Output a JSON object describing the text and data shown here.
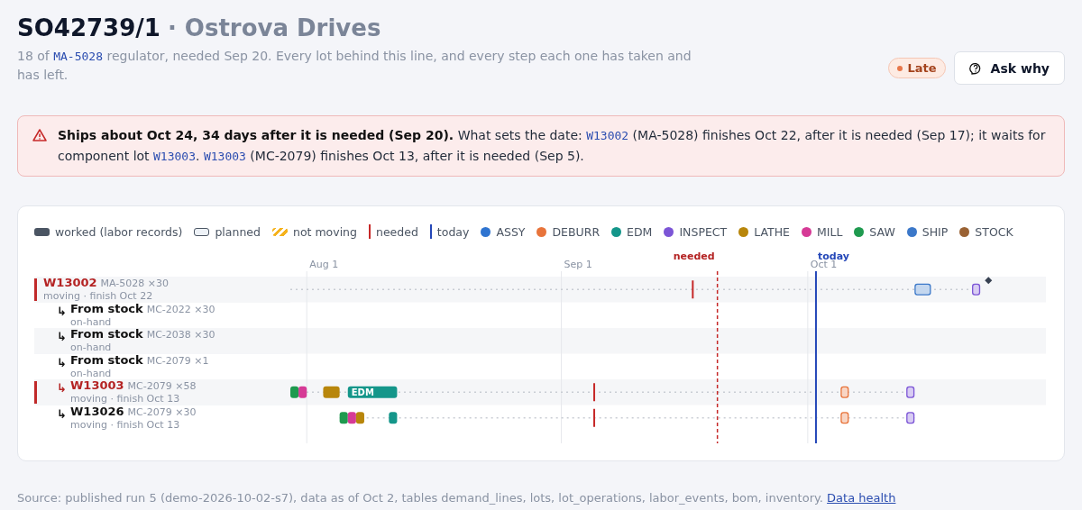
{
  "header": {
    "order": "SO42739/1",
    "customer": "· Ostrova Drives",
    "subtitle": [
      {
        "kind": "text",
        "text": "18 of "
      },
      {
        "kind": "code",
        "text": "MA-5028"
      },
      {
        "kind": "text",
        "text": " regulator, needed Sep 20. Every lot behind this line, and every step each one has taken and has left."
      }
    ],
    "status": {
      "label": "Late",
      "color": "#e8774a"
    },
    "button": "Ask why"
  },
  "alert": {
    "parts": [
      {
        "kind": "bold",
        "text": "Ships about Oct 24, 34 days after it is needed (Sep 20)."
      },
      {
        "kind": "text",
        "text": " What sets the date: "
      },
      {
        "kind": "code",
        "text": "W13002"
      },
      {
        "kind": "text",
        "text": " (MA-5028) finishes Oct 22, after it is needed (Sep 17); it waits for component lot "
      },
      {
        "kind": "code",
        "text": "W13003"
      },
      {
        "kind": "text",
        "text": ". "
      },
      {
        "kind": "code",
        "text": "W13003"
      },
      {
        "kind": "text",
        "text": " (MC-2079) finishes Oct 13, after it is needed (Sep 5)."
      }
    ]
  },
  "legend": [
    {
      "kind": "worked",
      "label": "worked (labor records)"
    },
    {
      "kind": "planned",
      "label": "planned"
    },
    {
      "kind": "stuck",
      "label": "not moving"
    },
    {
      "kind": "needed",
      "label": "needed"
    },
    {
      "kind": "today",
      "label": "today"
    },
    {
      "kind": "step",
      "label": "ASSY",
      "color": "#2f74d0"
    },
    {
      "kind": "step",
      "label": "DEBURR",
      "color": "#e8743b"
    },
    {
      "kind": "step",
      "label": "EDM",
      "color": "#14968a"
    },
    {
      "kind": "step",
      "label": "INSPECT",
      "color": "#7c55d6"
    },
    {
      "kind": "step",
      "label": "LATHE",
      "color": "#b8860b"
    },
    {
      "kind": "step",
      "label": "MILL",
      "color": "#d63a96"
    },
    {
      "kind": "step",
      "label": "SAW",
      "color": "#1f9a4f"
    },
    {
      "kind": "step",
      "label": "SHIP",
      "color": "#3b78c9"
    },
    {
      "kind": "step",
      "label": "STOCK",
      "color": "#9a6234"
    }
  ],
  "timeline": {
    "ticks": [
      {
        "label": "Aug 1"
      },
      {
        "label": "Sep 1"
      },
      {
        "label": "Oct 1"
      }
    ],
    "needed": {
      "label": "needed"
    },
    "today": {
      "label": "today"
    },
    "rows": [
      {
        "name": "W13002",
        "kind": "lot",
        "critical": true,
        "part": "MA-5028 ×30",
        "status": "moving · finish Oct 22",
        "ops": [
          {
            "kind": "planned",
            "color": "#3b78c9"
          },
          {
            "kind": "planned",
            "color": "#7c55d6"
          }
        ],
        "children": [
          {
            "prefix": "↳",
            "name": "From stock",
            "kind": "stock",
            "critical": false,
            "part": "MC-2022 ×30",
            "status": "on-hand"
          },
          {
            "prefix": "↳",
            "name": "From stock",
            "kind": "stock",
            "critical": false,
            "part": "MC-2038 ×30",
            "status": "on-hand"
          },
          {
            "prefix": "↳",
            "name": "From stock",
            "kind": "stock",
            "critical": false,
            "part": "MC-2079 ×1",
            "status": "on-hand"
          },
          {
            "prefix": "↳",
            "name": "W13003",
            "kind": "lot",
            "critical": true,
            "part": "MC-2079 ×58",
            "status": "moving · finish Oct 13",
            "ops": [
              {
                "kind": "worked",
                "color": "#1f9a4f"
              },
              {
                "kind": "worked",
                "color": "#d63a96"
              },
              {
                "kind": "worked",
                "color": "#b8860b"
              },
              {
                "kind": "worked",
                "color": "#14968a",
                "label": "EDM"
              },
              {
                "kind": "planned",
                "color": "#e8743b"
              },
              {
                "kind": "planned",
                "color": "#7c55d6"
              }
            ]
          },
          {
            "prefix": "↳",
            "name": "W13026",
            "kind": "lot",
            "critical": false,
            "part": "MC-2079 ×30",
            "status": "moving · finish Oct 13",
            "ops": [
              {
                "kind": "worked",
                "color": "#1f9a4f"
              },
              {
                "kind": "worked",
                "color": "#d63a96"
              },
              {
                "kind": "worked",
                "color": "#b8860b"
              },
              {
                "kind": "worked",
                "color": "#14968a"
              },
              {
                "kind": "planned",
                "color": "#e8743b"
              },
              {
                "kind": "planned",
                "color": "#7c55d6"
              }
            ]
          }
        ]
      }
    ]
  },
  "footer": {
    "source": "Source: published run 5 (demo-2026-10-02-s7), data as of Oct 2, tables demand_lines, lots, lot_operations, labor_events, bom, inventory.",
    "link": "Data health"
  }
}
